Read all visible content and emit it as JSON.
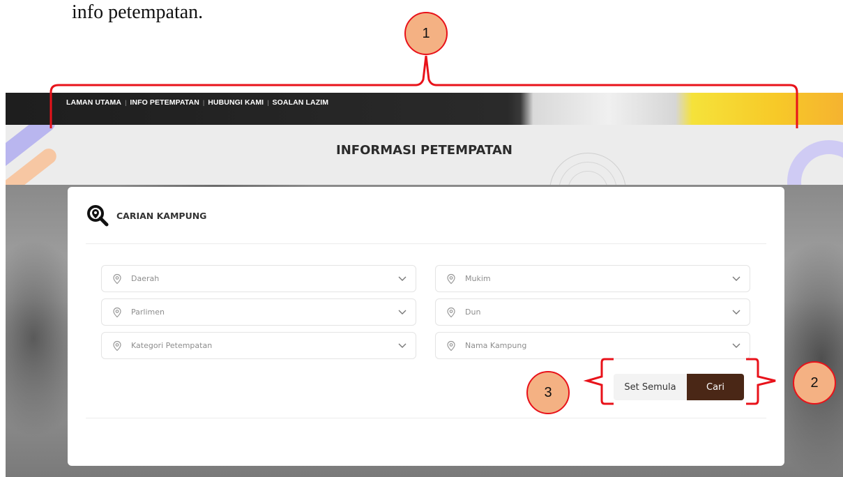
{
  "document": {
    "text": "info petempatan."
  },
  "callouts": [
    "1",
    "2",
    "3"
  ],
  "nav": {
    "items": [
      "LAMAN UTAMA",
      "INFO PETEMPATAN",
      "HUBUNGI KAMI",
      "SOALAN LAZIM"
    ],
    "separator": "|"
  },
  "banner": {
    "title": "INFORMASI PETEMPATAN"
  },
  "search_card": {
    "title": "CARIAN KAMPUNG",
    "icon": "magnifier-pin-icon",
    "fields": [
      {
        "placeholder": "Daerah",
        "icon": "location-pin-icon"
      },
      {
        "placeholder": "Mukim",
        "icon": "location-pin-icon"
      },
      {
        "placeholder": "Parlimen",
        "icon": "location-pin-icon"
      },
      {
        "placeholder": "Dun",
        "icon": "location-pin-icon"
      },
      {
        "placeholder": "Kategori Petempatan",
        "icon": "location-pin-icon"
      },
      {
        "placeholder": "Nama Kampung",
        "icon": "location-pin-icon"
      }
    ],
    "buttons": {
      "reset_label": "Set Semula",
      "search_label": "Cari"
    }
  },
  "colors": {
    "accent_button": "#4a2716",
    "callout_fill": "#f4b183",
    "callout_stroke": "#e8121a"
  }
}
